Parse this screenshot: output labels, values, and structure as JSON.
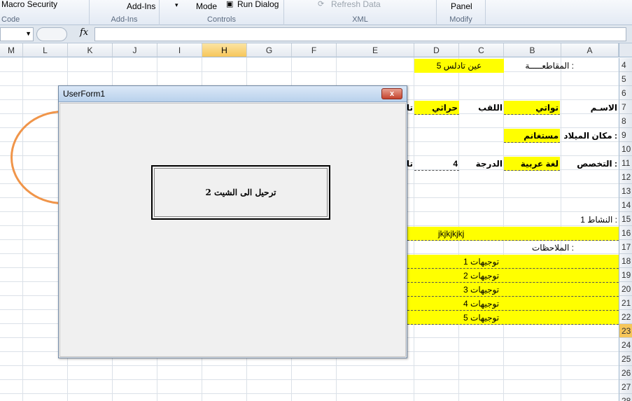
{
  "ribbon": {
    "macro_security": "Macro Security",
    "code_label": "Code",
    "addins_button": "Add-Ins",
    "addins_label": "Add-Ins",
    "mode_label": "Mode",
    "run_dialog": "Run Dialog",
    "controls_label": "Controls",
    "refresh_data": "Refresh Data",
    "xml_label": "XML",
    "panel": "Panel",
    "modify_label": "Modify"
  },
  "formula_bar": {
    "name_box": "",
    "fx": "fx",
    "value": ""
  },
  "columns": [
    "M",
    "L",
    "K",
    "J",
    "I",
    "H",
    "G",
    "F",
    "E",
    "D",
    "C",
    "B",
    "A"
  ],
  "selected_column": "H",
  "rows": [
    "4",
    "5",
    "6",
    "7",
    "8",
    "9",
    "10",
    "11",
    "12",
    "13",
    "14",
    "15",
    "16",
    "17",
    "18",
    "19",
    "20",
    "21",
    "22",
    "23",
    "24",
    "25",
    "26",
    "27",
    "28"
  ],
  "selected_row": "23",
  "cells": {
    "a4": "المقاطعـــــة :",
    "d4": "عين تادلس  5",
    "a7": "الاسـم",
    "b7": "تواتي",
    "c7": "اللقب",
    "d7": "حراثي",
    "e7": "تا",
    "a9": "مكان الميلاد :",
    "b9": "مستغانم",
    "a11": "التخصص :",
    "b11": "لغة عربية",
    "c11": "الدرجة",
    "d11": "4",
    "e11": "تا",
    "a15": "النشاط 1 :",
    "c16": "jkjkjkjkj",
    "b17": "الملاحظات :",
    "c18": "توجيهات 1",
    "c19": "توجيهات 2",
    "c20": "توجيهات 3",
    "c21": "توجيهات 4",
    "c22": "توجيهات 5"
  },
  "userform": {
    "title": "UserForm1",
    "close": "x",
    "button_label": "ترحيل الى الشيت 2"
  },
  "colors": {
    "highlight": "#ffff00",
    "shape_outline": "#f0954a",
    "selected_header": "#f6c65a"
  }
}
